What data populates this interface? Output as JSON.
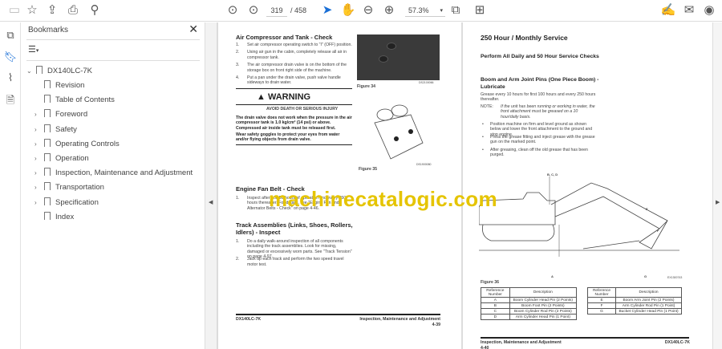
{
  "toolbar": {
    "page_current": "319",
    "page_total": "/ 458",
    "zoom": "57.3%",
    "icons": [
      "save-icon",
      "star-icon",
      "upload-icon",
      "print-icon",
      "search-icon",
      "prev-page-icon",
      "next-page-icon",
      "select-arrow-icon",
      "hand-icon",
      "zoom-out-icon",
      "zoom-in-icon",
      "fit-page-icon",
      "scroll-mode-icon",
      "sign-icon",
      "mail-icon",
      "account-icon"
    ]
  },
  "bookmarks": {
    "title": "Bookmarks",
    "root": "DX140LC-7K",
    "items": [
      {
        "label": "Revision",
        "expandable": false
      },
      {
        "label": "Table of Contents",
        "expandable": false
      },
      {
        "label": "Foreword",
        "expandable": true
      },
      {
        "label": "Safety",
        "expandable": true
      },
      {
        "label": "Operating Controls",
        "expandable": true
      },
      {
        "label": "Operation",
        "expandable": true
      },
      {
        "label": "Inspection, Maintenance and Adjustment",
        "expandable": true
      },
      {
        "label": "Transportation",
        "expandable": true
      },
      {
        "label": "Specification",
        "expandable": true
      },
      {
        "label": "Index",
        "expandable": false
      }
    ]
  },
  "watermark": "machinecatalogic.com",
  "left_page": {
    "h1": "Air Compressor and Tank - Check",
    "steps1": [
      "Set air compressor operating switch to \"I\" (OFF) position.",
      "Using air gun in the cabin, completely release all air in compressor tank.",
      "The air compressor drain valve is on the bottom of the storage box on front right side of the machine.",
      "Put a pan under the drain valve, push valve handle sideways to drain water."
    ],
    "warning_title": "WARNING",
    "warning_sub": "AVOID DEATH OR SERIOUS INJURY",
    "warning_p1": "The drain valve does not work when the pressure in the air compressor tank is 1.0 kg/cm² (14 psi) or above. Compressed air inside tank must be released first.",
    "warning_p2": "Wear safety goggles to protect your eyes from water and/or flying objects from drain valve.",
    "fig34": "Figure 34",
    "fig34_code": "DS2100066",
    "fig35": "Figure 35",
    "fig35_code": "DS1900080",
    "h2": "Engine Fan Belt - Check",
    "steps2": [
      "Inspect after first 50 hours of operation and every 250 hours thereafter. For details, see \"Engine Fan and Alternator Belts - Check\" on page 4-46."
    ],
    "h3": "Track Assemblies (Links, Shoes, Rollers, Idlers) - Inspect",
    "steps3": [
      "Do a daily walk-around inspection of all components including the track assemblies. Look for missing, damaged or excessively worn parts. See \"Track Tension\" on page 4-97.",
      "Jack up each track and perform the two speed travel motor test."
    ],
    "footer_left": "DX140LC-7K",
    "footer_right": "Inspection, Maintenance and Adjustment",
    "page_no": "4-39"
  },
  "right_page": {
    "h1": "250 Hour / Monthly Service",
    "h2": "Perform All Daily and 50 Hour Service Checks",
    "h3": "Boom and Arm Joint Pins (One Piece Boom) - Lubricate",
    "p1": "Grease every 10 hours for first 100 hours and every 250 hours thereafter.",
    "note_label": "NOTE:",
    "note": "If the unit has been running or working in water, the front attachment must be greased on a 10 hour/daily basis.",
    "bullets": [
      "Position machine on firm and level ground as shown below and lower the front attachment to the ground and stop engine.",
      "Press the grease fitting and inject grease with the grease gun on the marked point.",
      "After greasing, clean off the old grease that has been purged."
    ],
    "labels": {
      "bcd": "B, C, D",
      "e": "E",
      "f": "F",
      "a": "A",
      "g": "G"
    },
    "fig36": "Figure 36",
    "fig36_code": "EX1300743",
    "table_headers": [
      "Reference Number",
      "Description"
    ],
    "table1": [
      [
        "A",
        "Boom Cylinder Head Pin (2 Points)"
      ],
      [
        "B",
        "Boom Foot Pin (2 Points)"
      ],
      [
        "C",
        "Boom Cylinder Rod Pin (2 Points)"
      ],
      [
        "D",
        "Arm Cylinder Head Pin (1 Point)"
      ]
    ],
    "table2": [
      [
        "E",
        "Boom Arm Joint Pin (2 Points)"
      ],
      [
        "F",
        "Arm Cylinder Rod Pin (1 Point)"
      ],
      [
        "G",
        "Bucket Cylinder Head Pin (1 Point)"
      ]
    ],
    "footer_left": "Inspection, Maintenance and Adjustment",
    "page_no": "4-40",
    "footer_right": "DX140LC-7K"
  }
}
